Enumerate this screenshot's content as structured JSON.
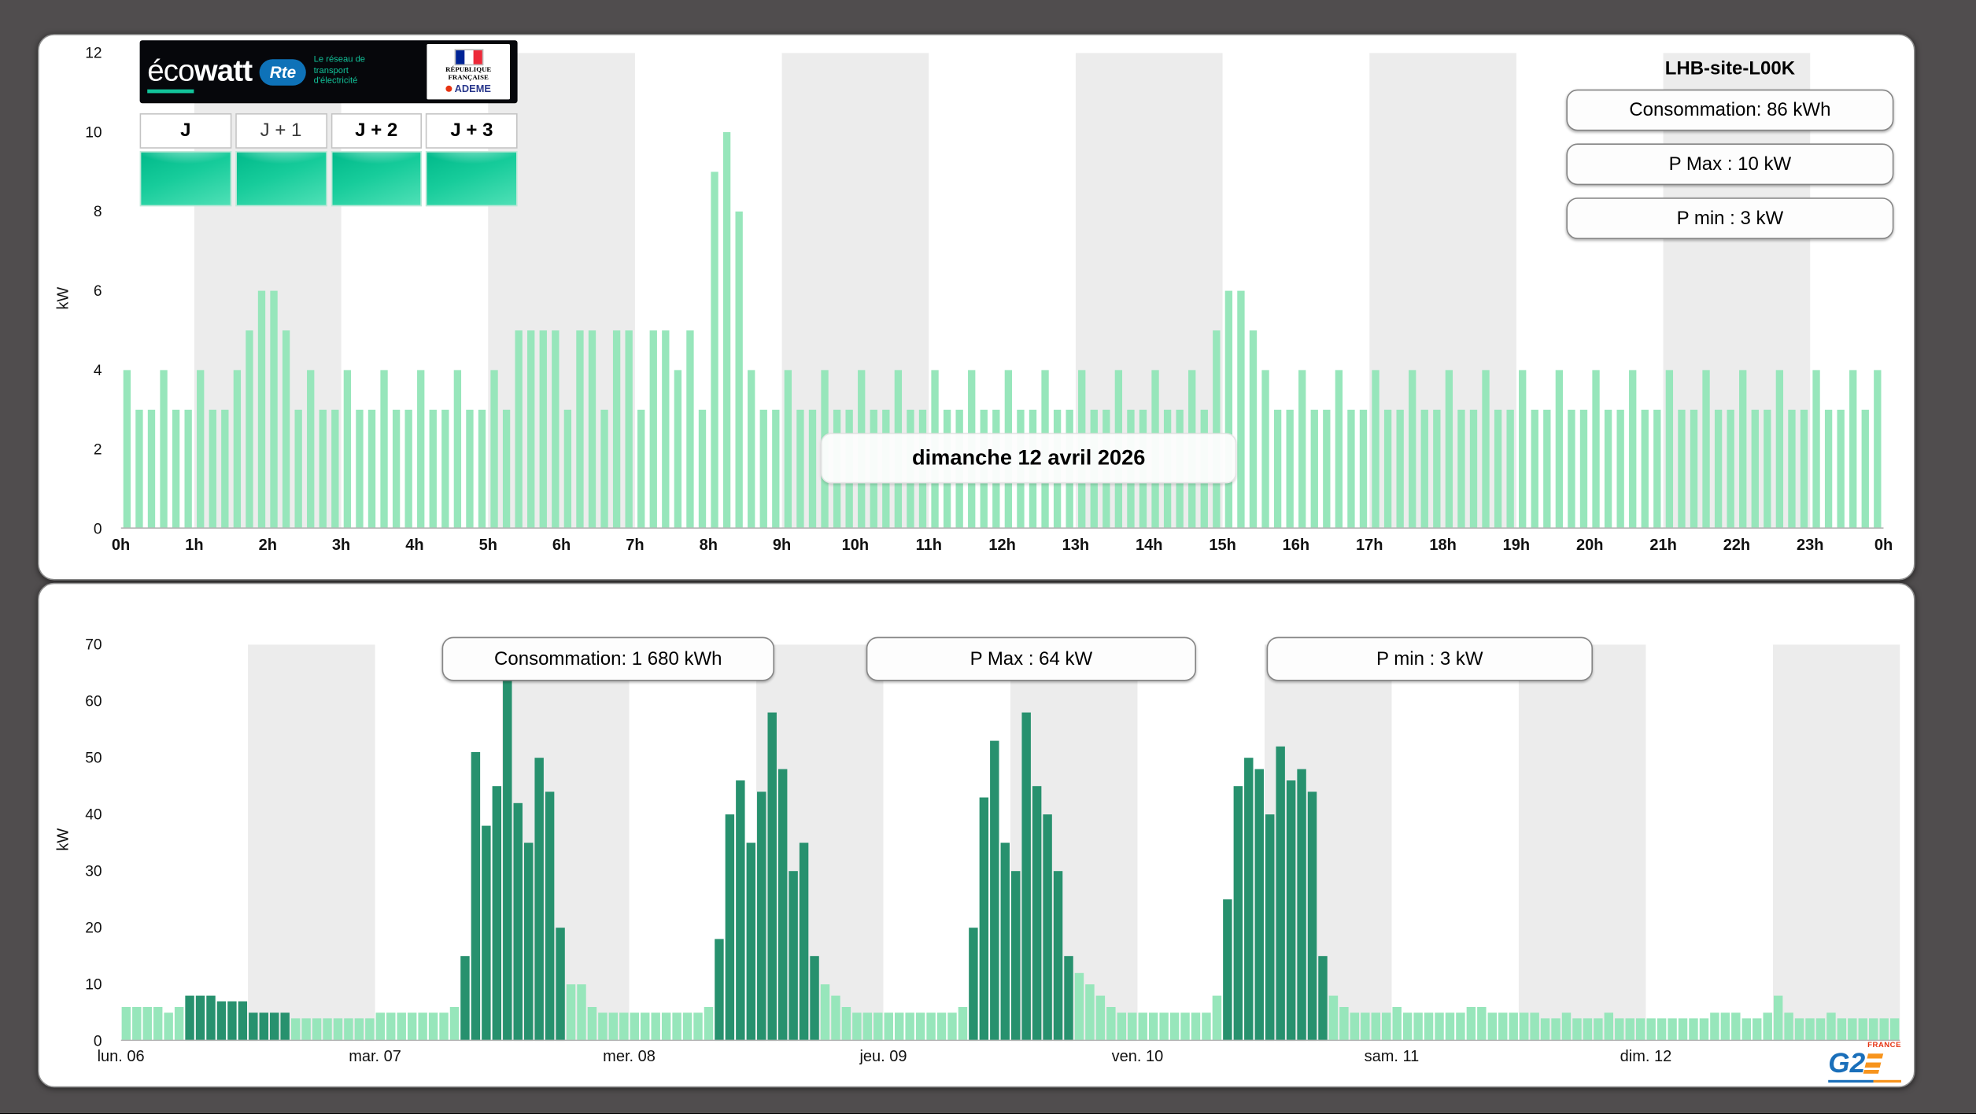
{
  "colors": {
    "page_bg": "#504d4e",
    "panel_bg": "#ffffff",
    "band_gray": "#ececec",
    "bar_light": "#97e6bb",
    "bar_dark": "#27916e",
    "badge_border": "#858585"
  },
  "header": {
    "site_label": "LHB-site-L00K",
    "badges": [
      "Consommation: 86 kWh",
      "P Max :  10 kW",
      "P min : 3 kW"
    ]
  },
  "ecowatt": {
    "brand_eco": "éco",
    "brand_watt": "watt",
    "rte_name": "Rte",
    "rte_tagline": "Le réseau de transport d'électricité",
    "gov_label": "RÉPUBLIQUE FRANÇAISE",
    "ademe_label": "ADEME",
    "days": [
      "J",
      "J + 1",
      "J + 2",
      "J + 3"
    ]
  },
  "bottom_badges": [
    "Consommation: 1 680 kWh",
    "P Max :  64 kW",
    "P min : 3 kW"
  ],
  "footer": {
    "g2_label": "G2",
    "france_label": "FRANCE"
  },
  "chart_data": [
    {
      "id": "daily-power",
      "type": "bar",
      "title": "dimanche 12 avril 2026",
      "ylabel": "kW",
      "ylim": [
        0,
        12
      ],
      "y_ticks": [
        0,
        2,
        4,
        6,
        8,
        10,
        12
      ],
      "x_labels": [
        "0h",
        "1h",
        "2h",
        "3h",
        "4h",
        "5h",
        "6h",
        "7h",
        "8h",
        "9h",
        "10h",
        "11h",
        "12h",
        "13h",
        "14h",
        "15h",
        "16h",
        "17h",
        "18h",
        "19h",
        "20h",
        "21h",
        "22h",
        "23h",
        "0h"
      ],
      "x_divisions": 24,
      "interval_minutes": 10,
      "bands": {
        "width_h": 2,
        "first_gray_h": 1,
        "total_h": 24
      },
      "colors": {
        "bar": "#97e6bb",
        "band": "#ececec"
      },
      "values": [
        4,
        3,
        3,
        4,
        3,
        3,
        4,
        3,
        3,
        4,
        5,
        6,
        6,
        5,
        3,
        4,
        3,
        3,
        4,
        3,
        3,
        4,
        3,
        3,
        4,
        3,
        3,
        4,
        3,
        3,
        4,
        3,
        5,
        5,
        5,
        5,
        3,
        5,
        5,
        3,
        5,
        5,
        3,
        5,
        5,
        4,
        5,
        3,
        9,
        10,
        8,
        4,
        3,
        3,
        4,
        3,
        3,
        4,
        3,
        3,
        4,
        3,
        3,
        4,
        3,
        3,
        4,
        3,
        3,
        4,
        3,
        3,
        4,
        3,
        3,
        4,
        3,
        3,
        4,
        3,
        3,
        4,
        3,
        3,
        4,
        3,
        3,
        4,
        3,
        5,
        6,
        6,
        5,
        4,
        3,
        3,
        4,
        3,
        3,
        4,
        3,
        3,
        4,
        3,
        3,
        4,
        3,
        3,
        4,
        3,
        3,
        4,
        3,
        3,
        4,
        3,
        3,
        4,
        3,
        3,
        4,
        3,
        3,
        4,
        3,
        3,
        4,
        3,
        3,
        4,
        3,
        3,
        4,
        3,
        3,
        4,
        3,
        3,
        4,
        3,
        3,
        4,
        3,
        4
      ]
    },
    {
      "id": "weekly-power",
      "type": "bar",
      "title": "",
      "ylabel": "kW",
      "ylim": [
        0,
        70
      ],
      "y_ticks": [
        0,
        10,
        20,
        30,
        40,
        50,
        60,
        70
      ],
      "x_labels": [
        "lun. 06",
        "mar. 07",
        "mer. 08",
        "jeu. 09",
        "ven. 10",
        "sam. 11",
        "dim. 12"
      ],
      "x_divisions": 7,
      "interval_minutes": 60,
      "bands": {
        "width_h": 12,
        "first_gray_h": 12,
        "total_h": 168
      },
      "colors": {
        "bar": "#97e6bb",
        "bar_dark": "#27916e",
        "band": "#ececec"
      },
      "dark_intervals_h": [
        [
          6,
          16
        ],
        [
          32,
          42
        ],
        [
          56,
          66
        ],
        [
          80,
          90
        ],
        [
          104,
          114
        ]
      ],
      "values": [
        6,
        6,
        6,
        6,
        5,
        6,
        8,
        8,
        8,
        7,
        7,
        7,
        5,
        5,
        5,
        5,
        4,
        4,
        4,
        4,
        4,
        4,
        4,
        4,
        5,
        5,
        5,
        5,
        5,
        5,
        5,
        6,
        15,
        51,
        38,
        45,
        64,
        42,
        35,
        50,
        44,
        20,
        10,
        10,
        6,
        5,
        5,
        5,
        5,
        5,
        5,
        5,
        5,
        5,
        5,
        6,
        18,
        40,
        46,
        35,
        44,
        58,
        48,
        30,
        35,
        15,
        10,
        8,
        6,
        5,
        5,
        5,
        5,
        5,
        5,
        5,
        5,
        5,
        5,
        6,
        20,
        43,
        53,
        35,
        30,
        58,
        45,
        40,
        30,
        15,
        12,
        10,
        8,
        6,
        5,
        5,
        5,
        5,
        5,
        5,
        5,
        5,
        5,
        8,
        25,
        45,
        50,
        48,
        40,
        52,
        46,
        48,
        44,
        15,
        8,
        6,
        5,
        5,
        5,
        5,
        6,
        5,
        5,
        5,
        5,
        5,
        5,
        6,
        6,
        5,
        5,
        5,
        5,
        5,
        4,
        4,
        5,
        4,
        4,
        4,
        5,
        4,
        4,
        4,
        4,
        4,
        4,
        4,
        4,
        4,
        5,
        5,
        5,
        4,
        4,
        5,
        8,
        5,
        4,
        4,
        4,
        5,
        4,
        4,
        4,
        4,
        4,
        4
      ]
    }
  ]
}
